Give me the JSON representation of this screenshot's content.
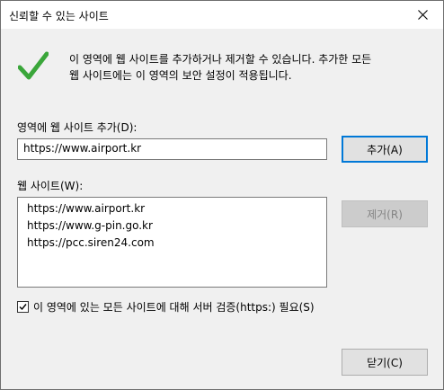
{
  "window": {
    "title": "신뢰할 수 있는 사이트"
  },
  "info": {
    "icon": "check-icon",
    "line1": "이 영역에 웹 사이트를 추가하거나 제거할 수 있습니다. 추가한 모든",
    "line2": "웹 사이트에는 이 영역의 보안 설정이 적용됩니다."
  },
  "add_section": {
    "label": "영역에 웹 사이트 추가(D):",
    "input_value": "https://www.airport.kr",
    "add_button": "추가(A)"
  },
  "sites_section": {
    "label": "웹 사이트(W):",
    "items": [
      "https://www.airport.kr",
      "https://www.g-pin.go.kr",
      "https://pcc.siren24.com"
    ],
    "remove_button": "제거(R)"
  },
  "verification": {
    "checked": true,
    "label": "이 영역에 있는 모든 사이트에 대해 서버 검증(https:) 필요(S)"
  },
  "footer": {
    "close_button": "닫기(C)"
  },
  "colors": {
    "accent": "#0078d7",
    "check_green": "#3aa63a",
    "dialog_bg": "#f0f0f0"
  }
}
